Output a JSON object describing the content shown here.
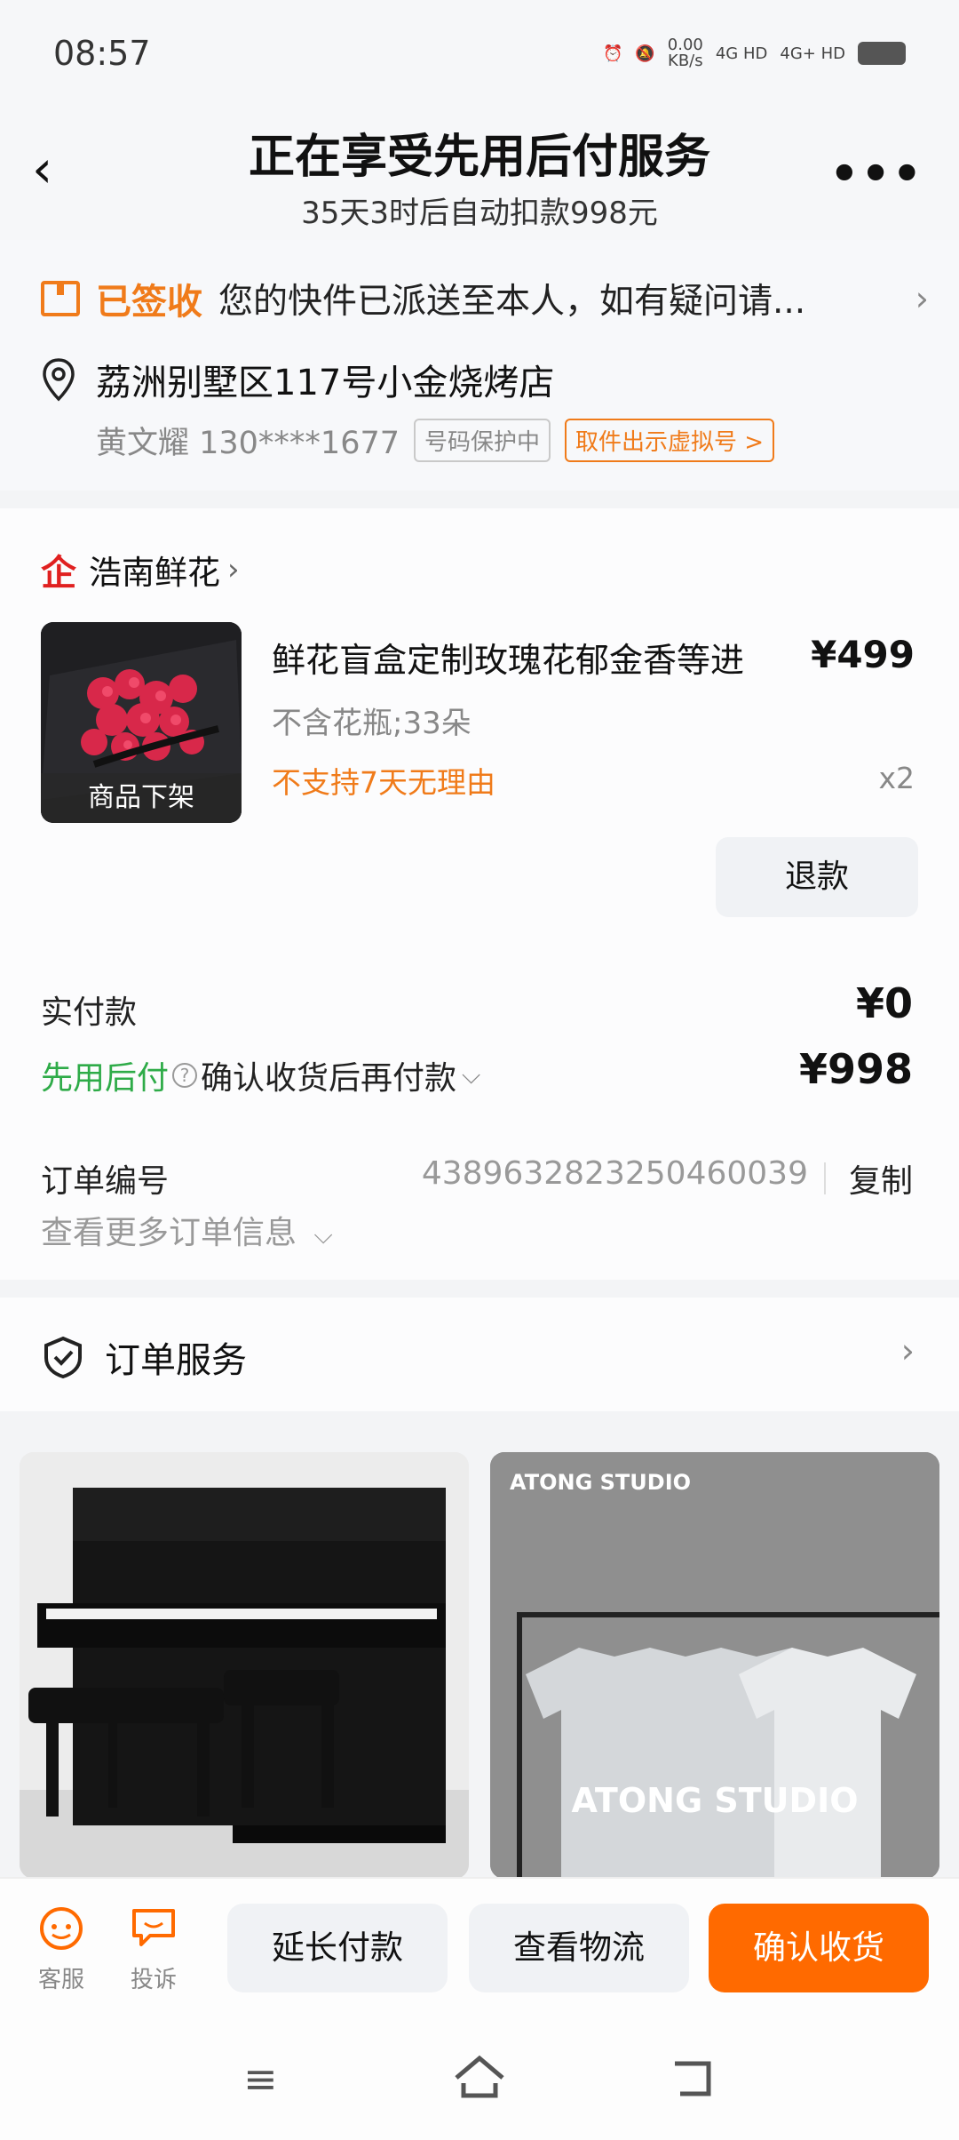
{
  "status_bar": {
    "time": "08:57",
    "speed": "0.00",
    "speed_unit": "KB/s",
    "net1": "4G HD",
    "net2": "4G+ HD"
  },
  "header": {
    "title": "正在享受先用后付服务",
    "subtitle": "35天3时后自动扣款998元",
    "back_icon": "back-chevron-icon",
    "more_icon": "more-dots-icon"
  },
  "logistics": {
    "status": "已签收",
    "message": "您的快件已派送至本人，如有疑问请...",
    "address": "荔洲别墅区117号小金烧烤店",
    "contact": "黄文耀 130****1677",
    "tag_protect": "号码保护中",
    "tag_virtual": "取件出示虚拟号 >",
    "chevron": "›"
  },
  "order": {
    "shop_icon": "企",
    "shop_name": "浩南鲜花",
    "shop_chevron": "›",
    "thumb_label": "商品下架",
    "product_name": "鲜花盲盒定制玫瑰花郁金香等进",
    "price": "¥499",
    "spec": "不含花瓶;33朵",
    "note": "不支持7天无理由",
    "qty": "x2",
    "refund_label": "退款",
    "paid_label": "实付款",
    "paid_amount": "¥0",
    "bnpl_label": "先用后付",
    "bnpl_desc": "确认收货后再付款",
    "bnpl_amount": "¥998",
    "order_no_label": "订单编号",
    "order_no": "4389632823250460039",
    "copy_label": "复制",
    "more_info": "查看更多订单信息"
  },
  "service": {
    "label": "订单服务",
    "chevron": "›"
  },
  "recommend": {
    "brand_small": "ATONG STUDIO",
    "brand_big": "ATONG STUDIO"
  },
  "bottom_bar": {
    "service_label": "客服",
    "complain_label": "投诉",
    "extend_label": "延长付款",
    "logistics_label": "查看物流",
    "confirm_label": "确认收货"
  },
  "colors": {
    "accent": "#ff6a00",
    "orange_text": "#f07b1a",
    "green": "#2eab48",
    "shop_red": "#e02020"
  }
}
